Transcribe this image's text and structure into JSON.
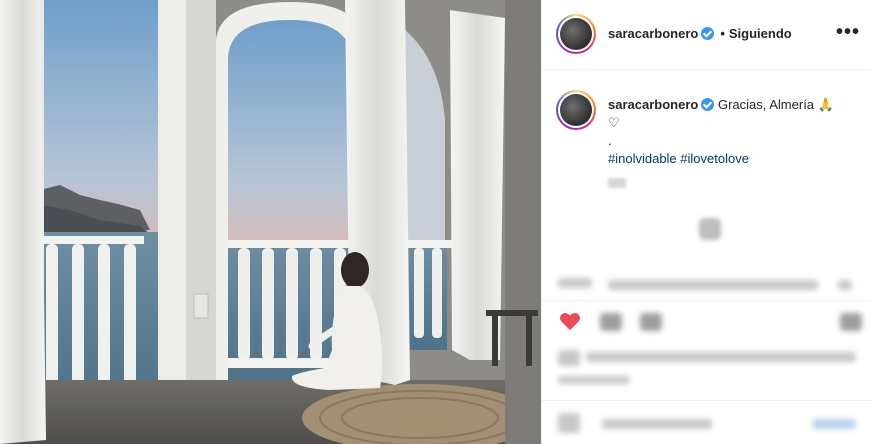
{
  "post": {
    "username": "saracarbonero",
    "dot": "•",
    "following_label": "Siguiendo",
    "more_label": "•••",
    "caption": "Gracias, Almería 🙏",
    "caption_heart": "♡",
    "caption_period": ".",
    "hashtags": "#inolvidable #ilovetolove"
  },
  "icons": {
    "like": "heart-icon",
    "verified": "verified-badge-icon",
    "more": "more-options-icon"
  },
  "colors": {
    "like_red": "#ed4956",
    "link": "#00376b",
    "verified": "#3897f0"
  }
}
